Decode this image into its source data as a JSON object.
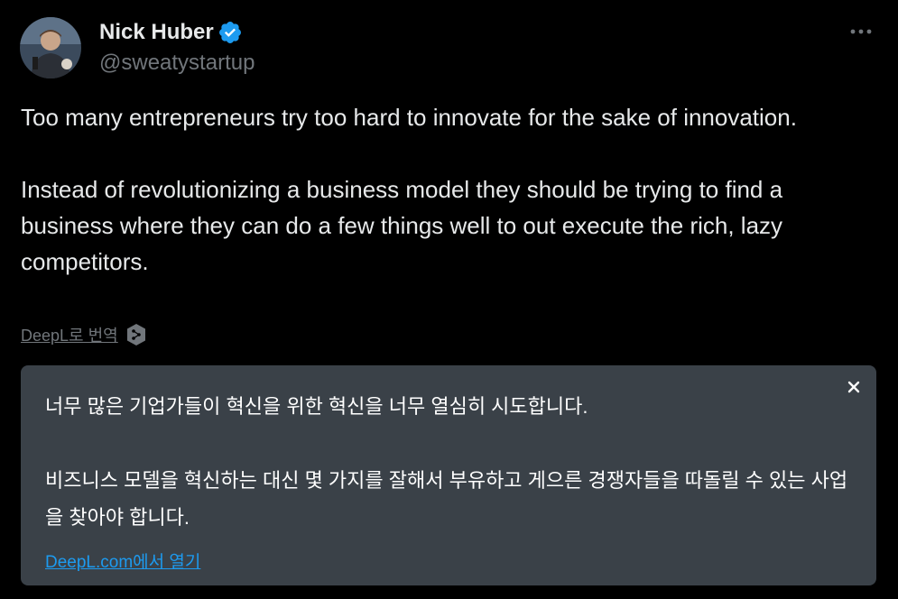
{
  "author": {
    "display_name": "Nick Huber",
    "handle": "@sweatystartup",
    "avatar_icon": "avatar-photo",
    "verified_icon": "verified-badge-icon",
    "verified_color": "#1d9bf0"
  },
  "header": {
    "more_icon": "more-dots-icon"
  },
  "tweet": {
    "paragraphs": [
      "Too many entrepreneurs try too hard to innovate for the sake of innovation.",
      "Instead of revolutionizing a business model they should be trying to find a business where they can do a few things well to out execute the rich, lazy competitors."
    ]
  },
  "translate": {
    "link_label": "DeepL로 번역",
    "icon": "deepl-icon"
  },
  "translation_box": {
    "paragraphs": [
      "너무 많은 기업가들이 혁신을 위한 혁신을 너무 열심히 시도합니다.",
      "비즈니스 모델을 혁신하는 대신 몇 가지를 잘해서 부유하고 게으른 경쟁자들을 따돌릴 수 있는 사업을 찾아야 합니다."
    ],
    "open_link_label": "DeepL.com에서 열기",
    "close_icon": "close-icon",
    "background_color": "#3a4148",
    "link_color": "#1d9bf0"
  },
  "colors": {
    "background": "#000000",
    "primary_text": "#e7e9ea",
    "secondary_text": "#71767b"
  }
}
